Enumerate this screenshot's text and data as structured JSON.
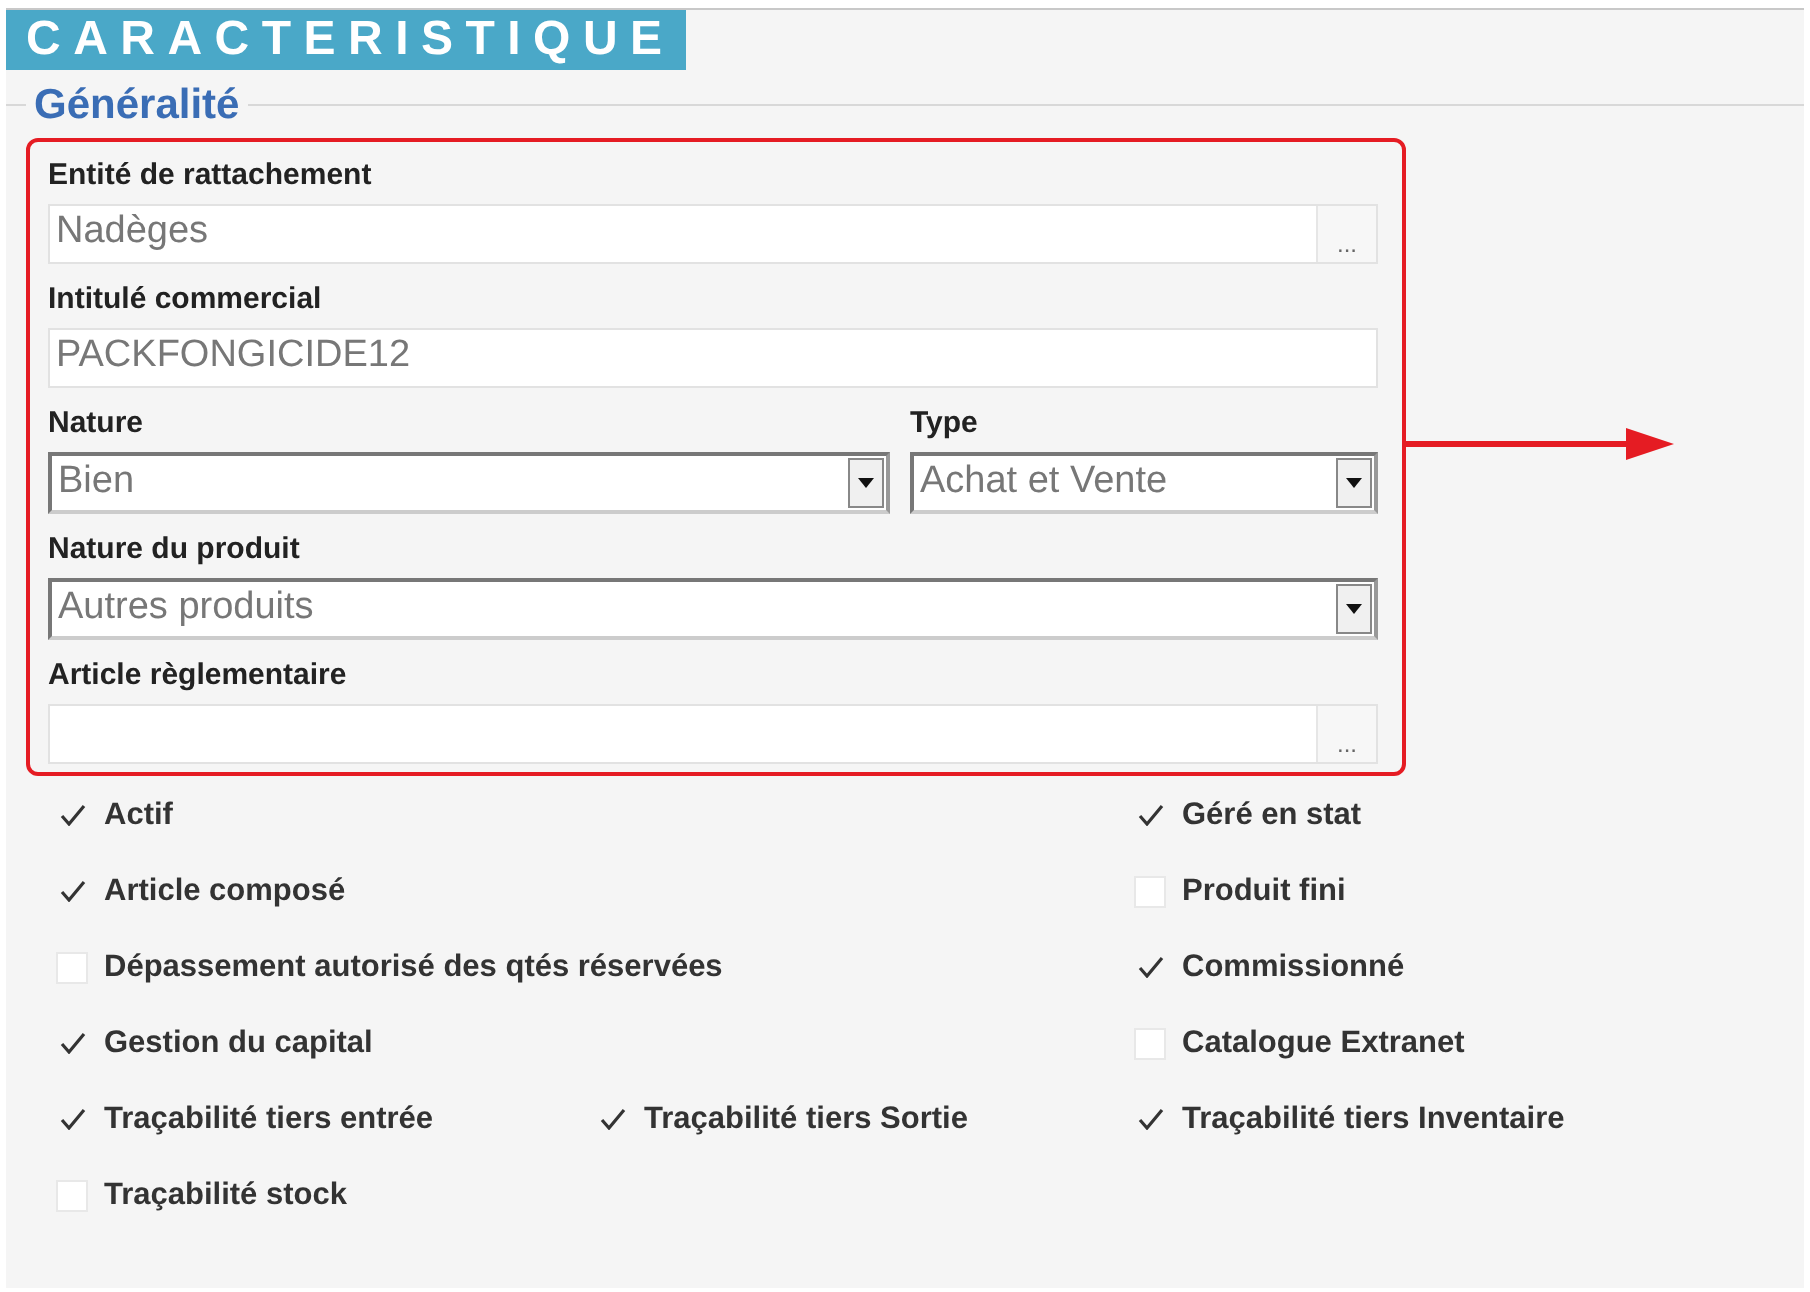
{
  "header": {
    "title": "CARACTERISTIQUE"
  },
  "section": {
    "title": "Généralité"
  },
  "field_rows": [
    {
      "fields": [
        {
          "kind": "lookup",
          "label": "Entité de rattachement",
          "value": "Nadèges",
          "button_text": "..."
        }
      ]
    },
    {
      "fields": [
        {
          "kind": "text",
          "label": "Intitulé commercial",
          "value": "PACKFONGICIDE12"
        }
      ]
    },
    {
      "fields": [
        {
          "kind": "select",
          "label": "Nature",
          "value": "Bien"
        },
        {
          "kind": "select",
          "label": "Type",
          "value": "Achat et Vente"
        }
      ]
    },
    {
      "fields": [
        {
          "kind": "select",
          "label": "Nature du produit",
          "value": "Autres produits"
        }
      ]
    },
    {
      "fields": [
        {
          "kind": "lookup",
          "label": "Article règlementaire",
          "button_text": "..."
        }
      ]
    }
  ],
  "checkbox_rows": [
    {
      "column_1": {
        "label": "Actif",
        "checked": true
      },
      "column_3": {
        "label": "Géré en stat",
        "checked": true
      }
    },
    {
      "column_1": {
        "label": "Article composé",
        "checked": true
      },
      "column_3": {
        "label": "Produit fini",
        "checked": false
      }
    },
    {
      "column_1": {
        "label": "Dépassement autorisé des qtés réservées",
        "checked": false
      },
      "column_3": {
        "label": "Commissionné",
        "checked": true
      }
    },
    {
      "column_1": {
        "label": "Gestion du capital",
        "checked": true
      },
      "column_3": {
        "label": "Catalogue Extranet",
        "checked": false
      }
    },
    {
      "column_1": {
        "label": "Traçabilité tiers entrée",
        "checked": true
      },
      "column_2": {
        "label": "Traçabilité tiers Sortie",
        "checked": true
      },
      "column_3": {
        "label": "Traçabilité tiers Inventaire",
        "checked": true
      }
    },
    {
      "column_1": {
        "label": "Traçabilité stock",
        "checked": false
      }
    }
  ]
}
